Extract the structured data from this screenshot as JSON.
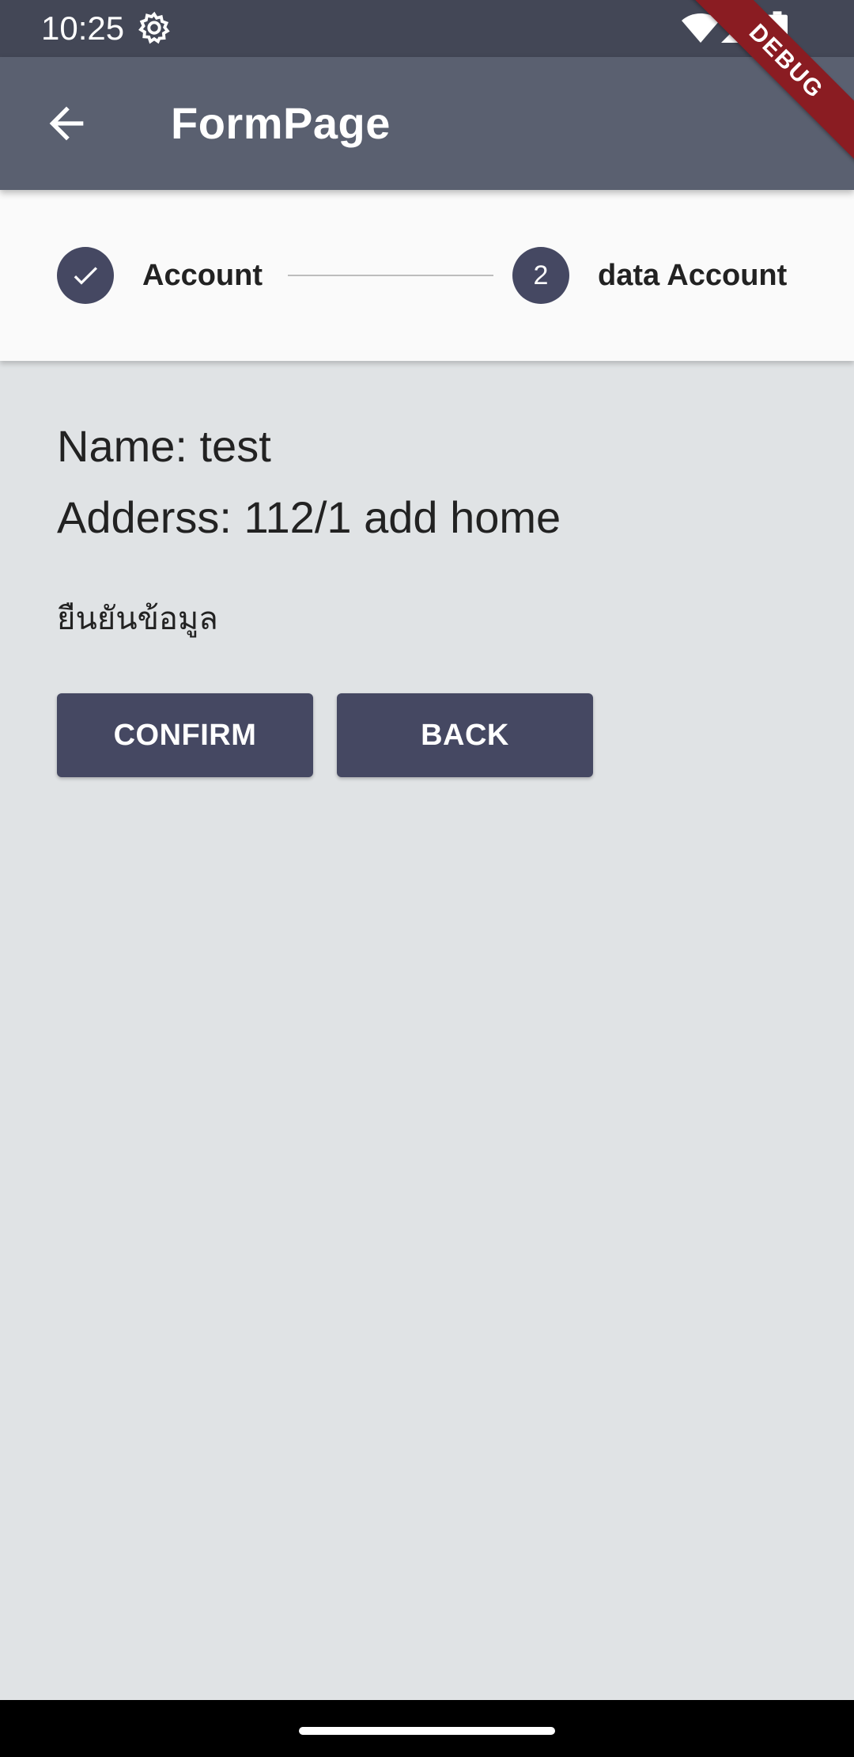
{
  "status_bar": {
    "time": "10:25",
    "icons": [
      "settings-gear-icon",
      "wifi-icon",
      "cellular-signal-icon",
      "battery-icon"
    ]
  },
  "debug_banner": {
    "label": "DEBUG",
    "color": "#8a1c22"
  },
  "app_bar": {
    "title": "FormPage",
    "back_icon": "arrow-back-icon",
    "background": "#5a6070"
  },
  "stepper": {
    "steps": [
      {
        "label": "Account",
        "state": "complete",
        "icon": "check-icon"
      },
      {
        "label": "data Account",
        "state": "active",
        "number": "2"
      }
    ],
    "accent": "#454862"
  },
  "content": {
    "name_line": "Name: test",
    "address_line": "Adderss: 112/1 add home",
    "confirm_prompt": "ยืนยันข้อมูล"
  },
  "buttons": {
    "confirm_label": "CONFIRM",
    "back_label": "BACK"
  },
  "colors": {
    "page_background": "#e0e3e5",
    "button": "#454862"
  }
}
